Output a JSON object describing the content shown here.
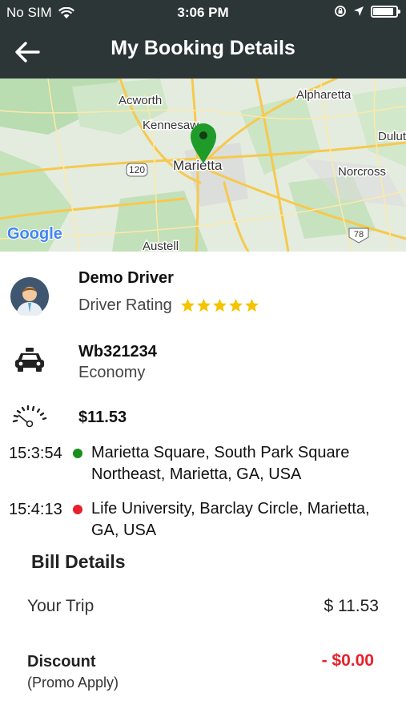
{
  "status_bar": {
    "carrier": "No SIM",
    "time": "3:06 PM",
    "battery_level": 0.9
  },
  "header": {
    "title": "My Booking Details"
  },
  "map": {
    "labels": {
      "acworth": "Acworth",
      "kennesaw": "Kennesaw",
      "marietta": "Marietta",
      "alpharetta": "Alpharetta",
      "duluth": "Dulut",
      "norcross": "Norcross",
      "austell": "Austell",
      "route120": "120",
      "route78": "78",
      "provider": "Google"
    },
    "pin_color": "#1f9b2a"
  },
  "driver": {
    "name": "Demo Driver",
    "rating_label": "Driver Rating",
    "rating": 5,
    "star_color": "#f5c400"
  },
  "vehicle": {
    "plate": "Wb321234",
    "type": "Economy"
  },
  "fare": {
    "amount": "$11.53"
  },
  "stops": [
    {
      "time": "15:3:54",
      "address": "Marietta Square, South Park Square Northeast, Marietta, GA, USA",
      "color": "#1a8f1a"
    },
    {
      "time": "15:4:13",
      "address": "Life University, Barclay Circle, Marietta, GA, USA",
      "color": "#e8202a"
    }
  ],
  "bill": {
    "title": "Bill Details",
    "trip_label": "Your Trip",
    "trip_value": "$ 11.53",
    "discount_label": "Discount",
    "discount_sub": "(Promo Apply)",
    "discount_value": "- $0.00"
  }
}
